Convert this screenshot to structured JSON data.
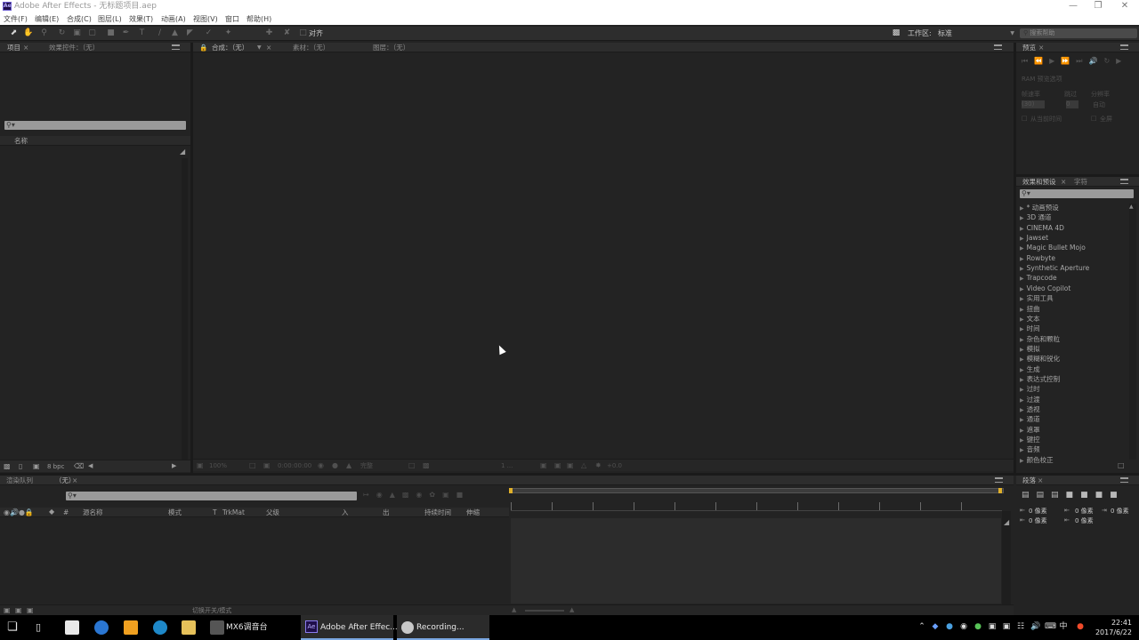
{
  "window": {
    "title": "Adobe After Effects - 无标题项目.aep",
    "logo": "Ae",
    "controls": [
      "minimize-icon",
      "maximize-icon",
      "close-icon"
    ]
  },
  "menu": [
    "文件(F)",
    "编辑(E)",
    "合成(C)",
    "图层(L)",
    "效果(T)",
    "动画(A)",
    "视图(V)",
    "窗口",
    "帮助(H)"
  ],
  "toolbar": {
    "align_label": "对齐",
    "workspace_label": "工作区:",
    "workspace_value": "标准",
    "search_placeholder": "搜索帮助"
  },
  "project_panel": {
    "tabs": [
      "项目",
      "效果控件：（无）"
    ],
    "name_column": "名称",
    "bpc": "8 bpc"
  },
  "viewer": {
    "tabs": [
      "合成：（无）",
      "素材：（无）",
      "图层：（无）"
    ],
    "zoom": "100%",
    "timecode": "0:00:00:00",
    "resolution": "完整",
    "views": "1 ...",
    "exposure": "+0.0"
  },
  "preview_panel": {
    "tab": "预览",
    "ram_label": "RAM 预览选项",
    "labels": [
      "帧速率",
      "跳过",
      "分辨率"
    ],
    "values": [
      "(30)",
      "0",
      "自动"
    ],
    "from_current": "从当前时间",
    "fullscreen": "全屏"
  },
  "effects_panel": {
    "tabs": [
      "效果和预设",
      "字符"
    ],
    "items": [
      "* 动画预设",
      "3D 通道",
      "CINEMA 4D",
      "Jawset",
      "Magic Bullet Mojo",
      "Rowbyte",
      "Synthetic Aperture",
      "Trapcode",
      "Video Copilot",
      "实用工具",
      "扭曲",
      "文本",
      "时间",
      "杂色和颗粒",
      "模拟",
      "模糊和锐化",
      "生成",
      "表达式控制",
      "过时",
      "过渡",
      "透视",
      "通道",
      "遮罩",
      "键控",
      "音频",
      "颜色校正"
    ]
  },
  "paragraph_panel": {
    "tab": "段落",
    "indent_values": [
      "0 像素",
      "0 像素",
      "0 像素",
      "0 像素",
      "0 像素"
    ]
  },
  "timeline": {
    "tabs": [
      "渲染队列",
      "（无）"
    ],
    "columns": [
      "#",
      "源名称",
      "模式",
      "T",
      "TrkMat",
      "父级",
      "入",
      "出",
      "持续时间",
      "伸缩"
    ],
    "bottom_label": "切换开关/模式"
  },
  "taskbar": {
    "apps": [
      {
        "label": "MX6调音台",
        "icon": "mixer-app-icon"
      },
      {
        "label": "Adobe After Effec...",
        "icon": "after-effects-icon"
      },
      {
        "label": "Recording...",
        "icon": "recording-icon"
      }
    ],
    "time": "22:41",
    "date": "2017/6/22",
    "ime": "中"
  },
  "colors": {
    "panel_bg": "#232323",
    "panel_header": "#2d2d2d",
    "accent_yellow": "#e0b02a",
    "taskbar": "#000000"
  }
}
